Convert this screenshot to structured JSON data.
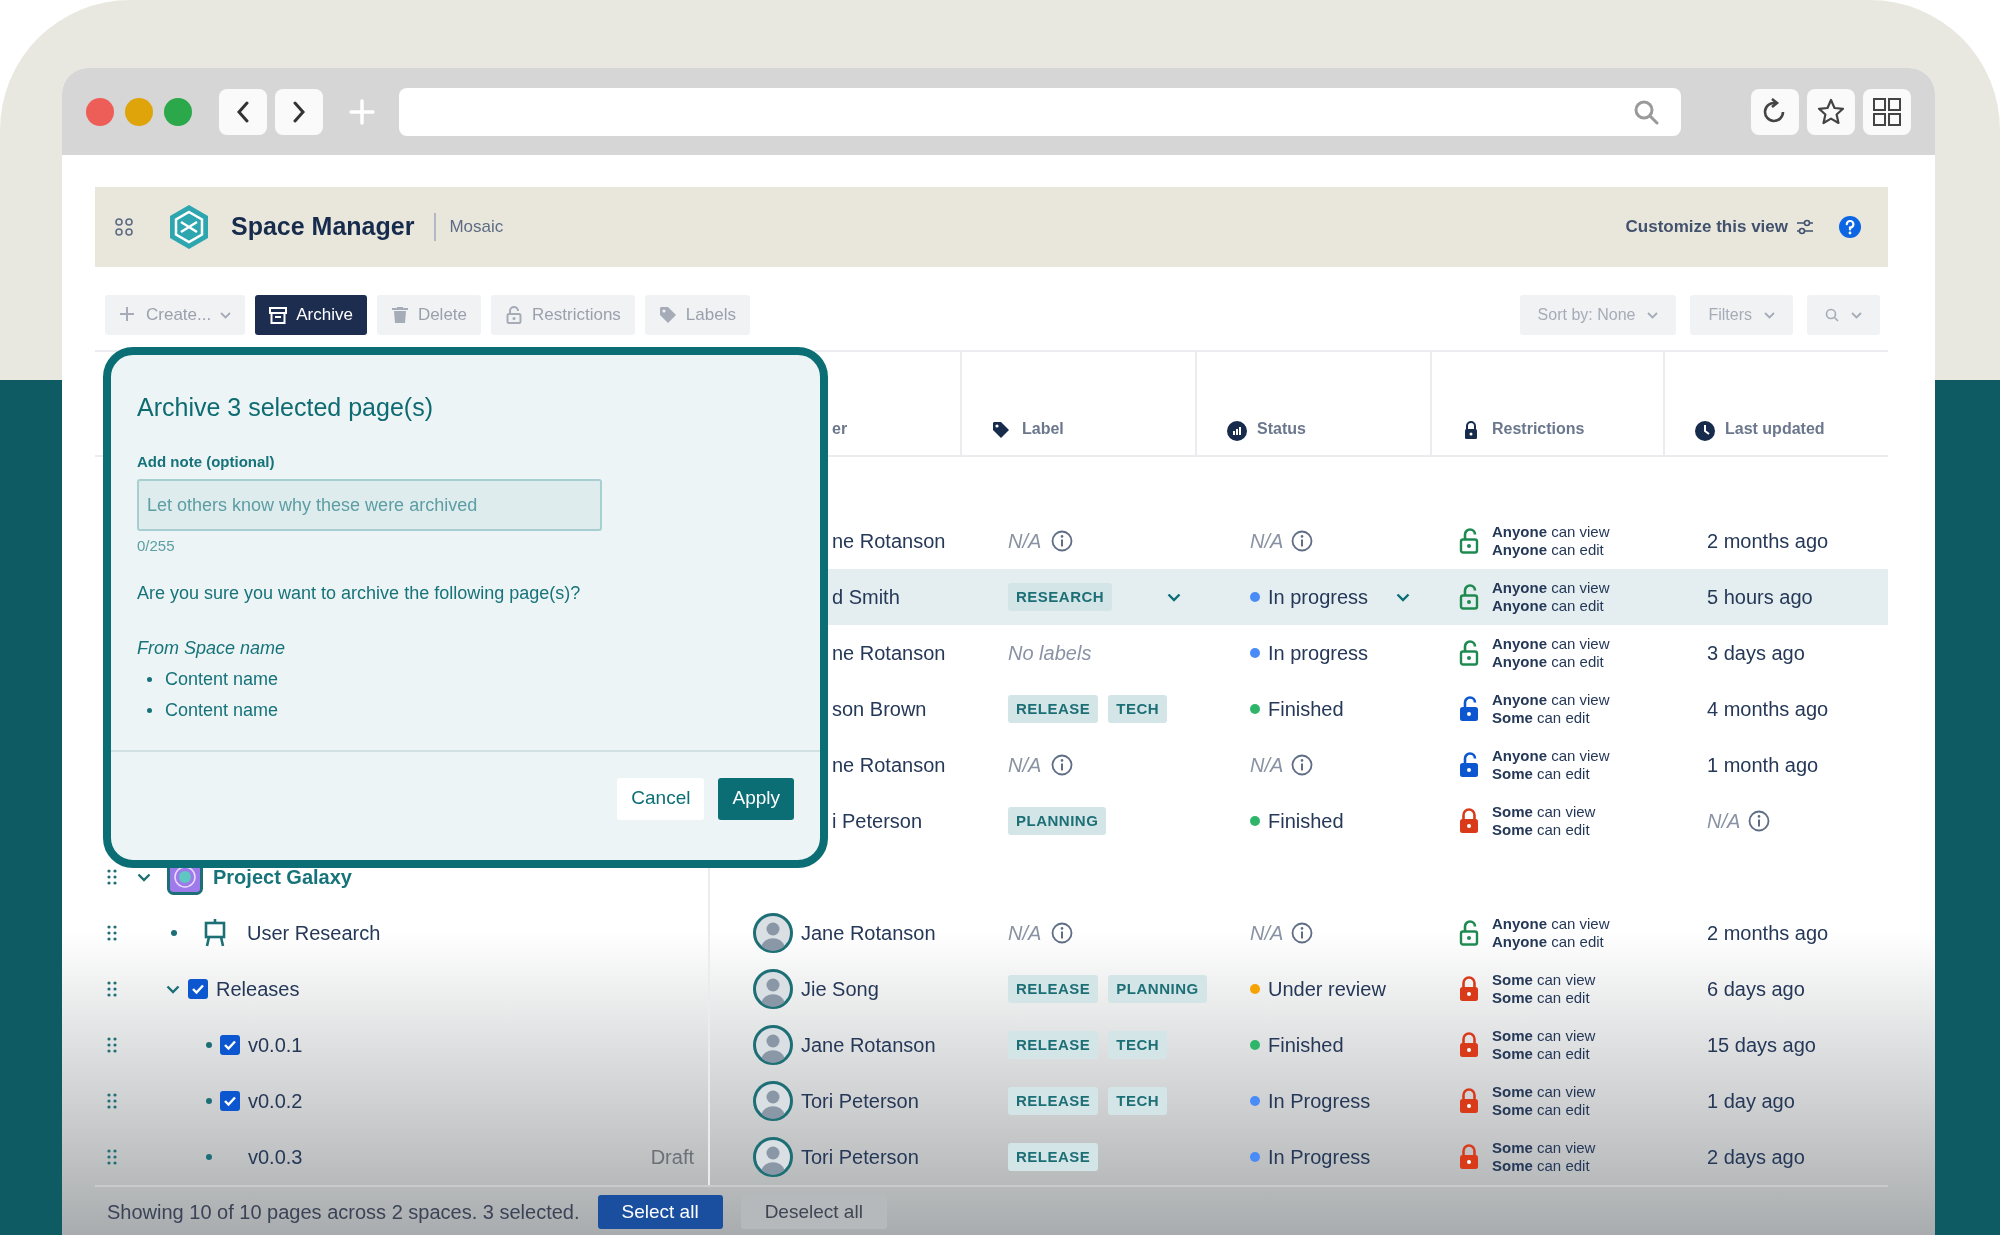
{
  "app": {
    "title": "Space Manager",
    "space": "Mosaic",
    "customize": "Customize this view"
  },
  "toolbar": {
    "actions": [
      {
        "label": "Create...",
        "kind": "create",
        "active": false
      },
      {
        "label": "Archive",
        "kind": "archive",
        "active": true
      },
      {
        "label": "Delete",
        "kind": "delete",
        "active": false
      },
      {
        "label": "Restrictions",
        "kind": "restrictions",
        "active": false
      },
      {
        "label": "Labels",
        "kind": "labels",
        "active": false
      }
    ],
    "sort": "Sort by: None",
    "filters": "Filters"
  },
  "columns": [
    {
      "label": "er",
      "kind": "owner"
    },
    {
      "label": "Label",
      "kind": "label"
    },
    {
      "label": "Status",
      "kind": "status"
    },
    {
      "label": "Restrictions",
      "kind": "restrictions"
    },
    {
      "label": "Last updated",
      "kind": "updated"
    }
  ],
  "groups": [
    {
      "rows": [
        {
          "selected": false,
          "owner": "ne Rotanson",
          "label": {
            "kind": "na",
            "text": "N/A"
          },
          "status": {
            "kind": "na",
            "text": "N/A"
          },
          "restriction": {
            "kind": "open",
            "lines": [
              "**Anyone** can view",
              "**Anyone** can  edit"
            ]
          },
          "updated": {
            "kind": "text",
            "text": "2 months ago"
          }
        },
        {
          "selected": true,
          "owner": "d Smith",
          "label": {
            "kind": "tags",
            "tags": [
              "RESEARCH"
            ],
            "dropdown": true
          },
          "status": {
            "kind": "dot",
            "text": "In progress",
            "color": "#4a8cf7",
            "dropdown": true
          },
          "restriction": {
            "kind": "open",
            "lines": [
              "**Anyone** can view",
              "**Anyone** can edit"
            ]
          },
          "updated": {
            "kind": "text",
            "text": "5 hours ago"
          }
        },
        {
          "selected": false,
          "owner": "ne Rotanson",
          "label": {
            "kind": "empty",
            "text": "No labels"
          },
          "status": {
            "kind": "dot",
            "text": "In progress",
            "color": "#4a8cf7"
          },
          "restriction": {
            "kind": "open",
            "lines": [
              "**Anyone** can view",
              "**Anyone** can edit"
            ]
          },
          "updated": {
            "kind": "text",
            "text": "3 days ago"
          }
        },
        {
          "selected": false,
          "owner": "son Brown",
          "label": {
            "kind": "tags",
            "tags": [
              "RELEASE",
              "TECH"
            ]
          },
          "status": {
            "kind": "dot",
            "text": "Finished",
            "color": "#2fb56a"
          },
          "restriction": {
            "kind": "partial",
            "lines": [
              "**Anyone** can view",
              "**Some** can edit"
            ]
          },
          "updated": {
            "kind": "text",
            "text": "4 months ago"
          }
        },
        {
          "selected": false,
          "owner": "ne Rotanson",
          "label": {
            "kind": "na",
            "text": "N/A"
          },
          "status": {
            "kind": "na",
            "text": "N/A"
          },
          "restriction": {
            "kind": "partial",
            "lines": [
              "**Anyone** can view",
              "**Some** can edit"
            ]
          },
          "updated": {
            "kind": "text",
            "text": "1 month ago"
          }
        },
        {
          "selected": false,
          "owner": "i Peterson",
          "label": {
            "kind": "tags",
            "tags": [
              "PLANNING"
            ]
          },
          "status": {
            "kind": "dot",
            "text": "Finished",
            "color": "#2fb56a"
          },
          "restriction": {
            "kind": "closed",
            "lines": [
              "**Some** can view",
              "**Some** can edit"
            ]
          },
          "updated": {
            "kind": "na",
            "text": "N/A"
          }
        }
      ]
    },
    {
      "space": {
        "title": "Project Galaxy",
        "expanded": true,
        "children": [
          {
            "title": "User Research",
            "kind": "whiteboard"
          },
          {
            "title": "Releases",
            "expanded": true,
            "checked": true,
            "children": [
              {
                "title": "v0.0.1",
                "checked": true
              },
              {
                "title": "v0.0.2",
                "checked": true
              },
              {
                "title": "v0.0.3",
                "checked": false,
                "status": "Draft"
              }
            ]
          }
        ]
      },
      "rows": [
        {
          "selected": false,
          "owner": "Jane Rotanson",
          "avatar": true,
          "label": {
            "kind": "na",
            "text": "N/A"
          },
          "status": {
            "kind": "na",
            "text": "N/A"
          },
          "restriction": {
            "kind": "open",
            "lines": [
              "**Anyone** can view",
              "**Anyone** can edit"
            ]
          },
          "updated": {
            "kind": "text",
            "text": "2 months ago"
          }
        },
        {
          "selected": false,
          "owner": "Jie Song",
          "avatar": true,
          "label": {
            "kind": "tags",
            "tags": [
              "RELEASE",
              "PLANNING"
            ]
          },
          "status": {
            "kind": "dot",
            "text": "Under review",
            "color": "#f5a300"
          },
          "restriction": {
            "kind": "closed",
            "lines": [
              "**Some** can view",
              "**Some** can edit"
            ]
          },
          "updated": {
            "kind": "text",
            "text": "6 days ago"
          }
        },
        {
          "selected": false,
          "owner": "Jane Rotanson",
          "avatar": true,
          "label": {
            "kind": "tags",
            "tags": [
              "RELEASE",
              "TECH"
            ]
          },
          "status": {
            "kind": "dot",
            "text": "Finished",
            "color": "#2fb56a"
          },
          "restriction": {
            "kind": "closed",
            "lines": [
              "**Some** can view",
              "**Some** can edit"
            ]
          },
          "updated": {
            "kind": "text",
            "text": "15 days ago"
          }
        },
        {
          "selected": false,
          "owner": "Tori Peterson",
          "avatar": true,
          "label": {
            "kind": "tags",
            "tags": [
              "RELEASE",
              "TECH"
            ]
          },
          "status": {
            "kind": "dot",
            "text": "In Progress",
            "color": "#4a8cf7"
          },
          "restriction": {
            "kind": "closed",
            "lines": [
              "**Some** can view",
              "**Some** can edit"
            ]
          },
          "updated": {
            "kind": "text",
            "text": "1 day ago"
          }
        },
        {
          "selected": false,
          "owner": "Tori Peterson",
          "avatar": true,
          "label": {
            "kind": "tags",
            "tags": [
              "RELEASE"
            ]
          },
          "status": {
            "kind": "dot",
            "text": "In Progress",
            "color": "#4a8cf7"
          },
          "restriction": {
            "kind": "closed",
            "lines": [
              "**Some** can view",
              "**Some** can edit"
            ]
          },
          "updated": {
            "kind": "text",
            "text": "2 days ago"
          }
        }
      ]
    }
  ],
  "dialog": {
    "title": "Archive 3 selected page(s)",
    "note_label": "Add note (optional)",
    "placeholder": "Let others know why these were archived",
    "counter": "0/255",
    "question": "Are you sure you want to archive the following page(s)?",
    "group": "From Space name",
    "items": [
      "Content name",
      "Content name"
    ],
    "buttons": [
      {
        "label": "Cancel",
        "kind": "secondary"
      },
      {
        "label": "Apply",
        "kind": "primary"
      }
    ]
  },
  "footer": {
    "summary": "Showing 10 of 10 pages across 2 spaces. 3 selected.",
    "buttons": [
      {
        "label": "Select all",
        "kind": "primary"
      },
      {
        "label": "Deselect all",
        "kind": "secondary"
      }
    ]
  }
}
